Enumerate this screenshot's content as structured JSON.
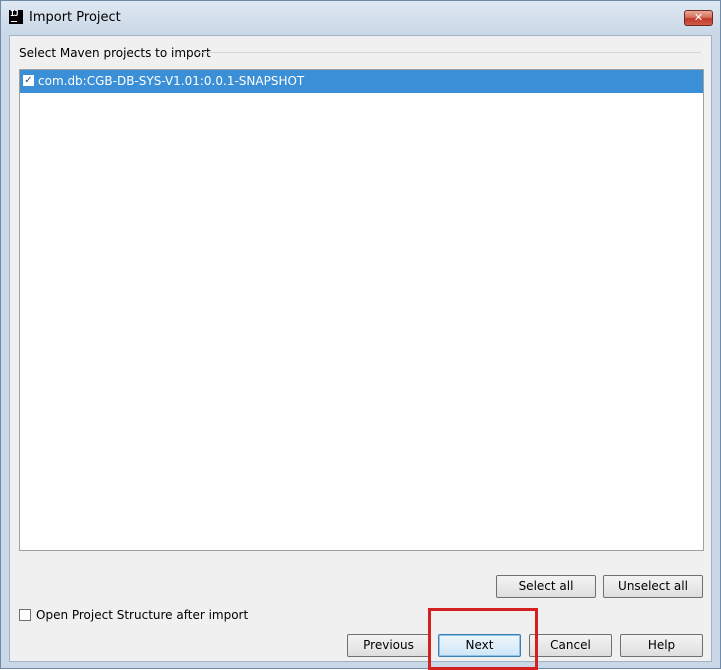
{
  "window": {
    "title": "Import Project",
    "close_glyph": "✕"
  },
  "app_icon": "IJ",
  "section_label": "Select Maven projects to import",
  "projects": [
    {
      "label": "com.db:CGB-DB-SYS-V1.01:0.0.1-SNAPSHOT",
      "checked": true,
      "selected": true
    }
  ],
  "checkmark_glyph": "✓",
  "buttons": {
    "select_all": "Select all",
    "unselect_all": "Unselect all",
    "previous": "Previous",
    "next": "Next",
    "cancel": "Cancel",
    "help": "Help"
  },
  "open_structure": {
    "label": "Open Project Structure after import",
    "checked": false
  },
  "colors": {
    "selection": "#3a8fd6",
    "highlight_box": "#d32020"
  }
}
